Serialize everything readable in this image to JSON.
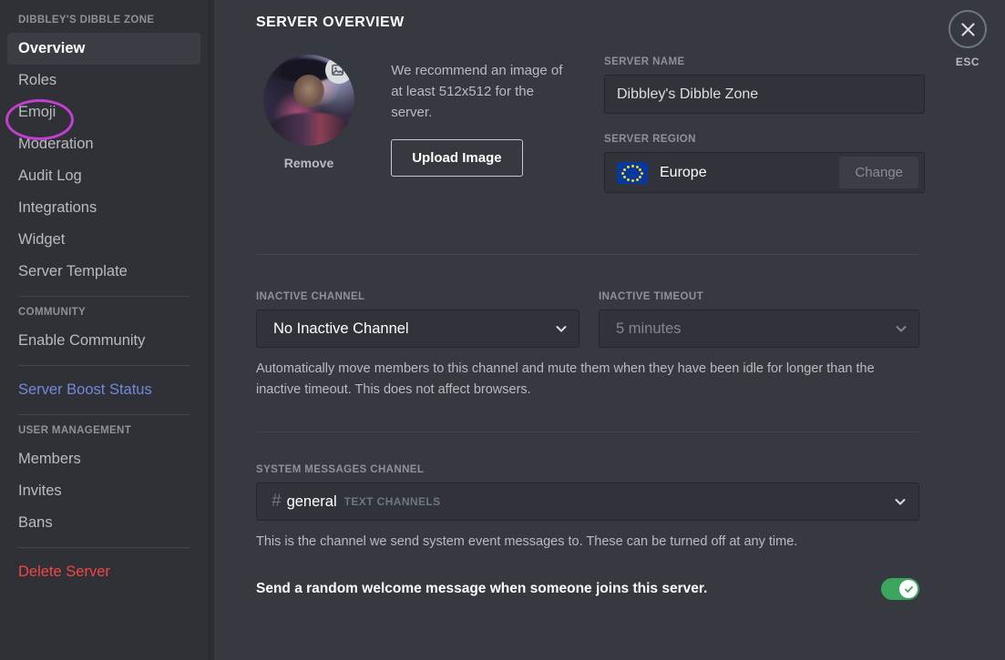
{
  "sidebar": {
    "server_header": "DIBBLEY'S DIBBLE ZONE",
    "items": [
      {
        "label": "Overview",
        "state": "active"
      },
      {
        "label": "Roles",
        "state": "normal"
      },
      {
        "label": "Emoji",
        "state": "normal"
      },
      {
        "label": "Moderation",
        "state": "normal"
      },
      {
        "label": "Audit Log",
        "state": "normal"
      },
      {
        "label": "Integrations",
        "state": "normal"
      },
      {
        "label": "Widget",
        "state": "normal"
      },
      {
        "label": "Server Template",
        "state": "normal"
      }
    ],
    "community_header": "COMMUNITY",
    "community_item": "Enable Community",
    "boost_item": "Server Boost Status",
    "user_management_header": "USER MANAGEMENT",
    "user_items": [
      {
        "label": "Members"
      },
      {
        "label": "Invites"
      },
      {
        "label": "Bans"
      }
    ],
    "delete_item": "Delete Server",
    "annotation_color": "#c33fd0",
    "active_color": "#ffffff",
    "link_color": "#7289da",
    "danger_color": "#f04747"
  },
  "header": {
    "title": "SERVER OVERVIEW",
    "esc_label": "ESC"
  },
  "image_section": {
    "remove_label": "Remove",
    "hint": "We recommend an image of at least 512x512 for the server.",
    "upload_label": "Upload Image",
    "badge_icon": "add-image-icon"
  },
  "server_name": {
    "label": "SERVER NAME",
    "value": "Dibbley's Dibble Zone"
  },
  "server_region": {
    "label": "SERVER REGION",
    "value": "Europe",
    "flag_icon": "eu-flag-icon",
    "change_label": "Change"
  },
  "inactive": {
    "channel_label": "INACTIVE CHANNEL",
    "channel_value": "No Inactive Channel",
    "timeout_label": "INACTIVE TIMEOUT",
    "timeout_value": "5 minutes",
    "helper": "Automatically move members to this channel and mute them when they have been idle for longer than the inactive timeout. This does not affect browsers."
  },
  "system_messages": {
    "label": "SYSTEM MESSAGES CHANNEL",
    "channel_name": "general",
    "channel_category": "TEXT CHANNELS",
    "hash_icon": "hash-icon",
    "helper": "This is the channel we send system event messages to. These can be turned off at any time.",
    "toggle_label": "Send a random welcome message when someone joins this server.",
    "toggle_state": "on",
    "toggle_color": "#3ba55d"
  }
}
